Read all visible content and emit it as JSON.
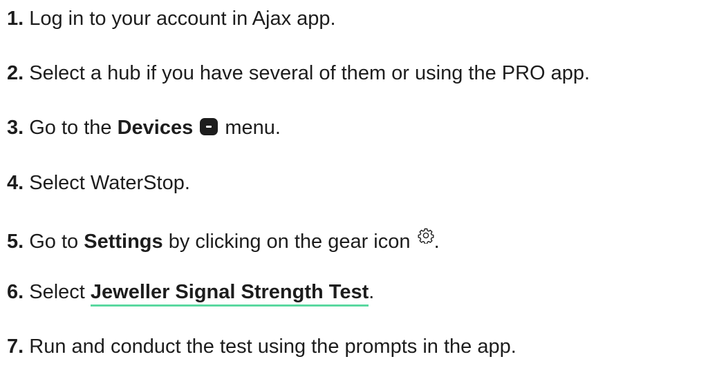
{
  "steps": [
    {
      "num": "1.",
      "text": " Log in to your account in Ajax app."
    },
    {
      "num": "2.",
      "text": " Select a hub if you have several of them or using the PRO app."
    },
    {
      "num": "3.",
      "pre": " Go to the ",
      "bold": "Devices",
      "post": " menu.",
      "icon": "devices-icon"
    },
    {
      "num": "4.",
      "text": " Select WaterStop."
    },
    {
      "num": "5.",
      "pre": " Go to ",
      "bold": "Settings",
      "mid": " by clicking on the gear icon ",
      "post": ".",
      "icon": "gear-icon"
    },
    {
      "num": "6.",
      "pre": " Select ",
      "link": "Jeweller Signal Strength Test",
      "post": "."
    },
    {
      "num": "7.",
      "text": " Run and conduct the test using the prompts in the app."
    }
  ],
  "colors": {
    "text": "#1d1d1d",
    "link_underline": "#5ad8a0"
  }
}
